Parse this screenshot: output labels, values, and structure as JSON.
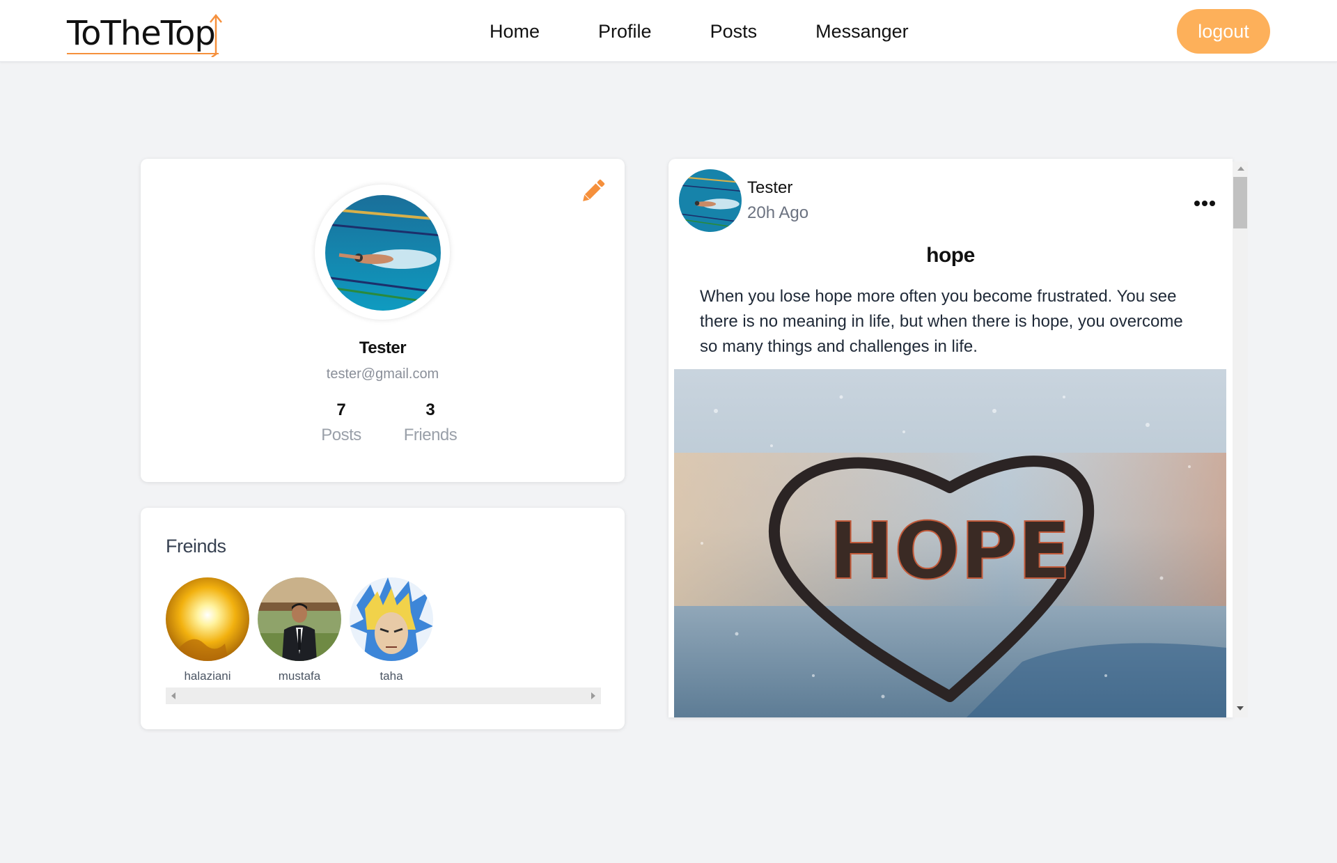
{
  "header": {
    "logo_text": "ToTheTop",
    "nav": [
      "Home",
      "Profile",
      "Posts",
      "Messanger"
    ],
    "logout_label": "logout"
  },
  "profile": {
    "name": "Tester",
    "email": "tester@gmail.com",
    "stats": [
      {
        "value": "7",
        "label": "Posts"
      },
      {
        "value": "3",
        "label": "Friends"
      }
    ],
    "edit_icon": "pencil-icon",
    "avatar": "swimmer-photo"
  },
  "friends": {
    "title": "Freinds",
    "items": [
      {
        "name": "halaziani",
        "avatar": "sun-photo"
      },
      {
        "name": "mustafa",
        "avatar": "man-in-suit-photo"
      },
      {
        "name": "taha",
        "avatar": "anime-character-photo"
      }
    ]
  },
  "post": {
    "author": "Tester",
    "time": "20h Ago",
    "title": "hope",
    "body": "When you lose hope more often you become frustrated. You see there is no meaning in life, but when there is hope, you overcome so many things and challenges in life.",
    "image_text": "HOPE",
    "menu_icon": "more-horizontal-icon"
  },
  "colors": {
    "accent": "#fdb05a",
    "edit_icon": "#f5903c",
    "background": "#f2f3f5"
  }
}
